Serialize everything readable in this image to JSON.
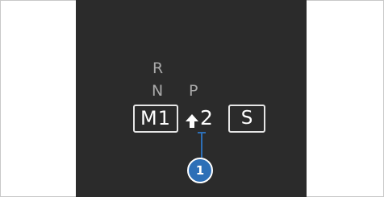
{
  "gear_indicator": {
    "reverse": "R",
    "neutral": "N",
    "park": "P",
    "manual_mode": "M1",
    "shift_arrow": "up-arrow-icon",
    "gear_number": "2",
    "drive_program": "S"
  },
  "callout": {
    "number": "1",
    "color": "#2d6fb7"
  },
  "colors": {
    "display_background": "#2b2b2b",
    "inactive_text": "#a9a9a9",
    "active_text": "#ffffff"
  }
}
